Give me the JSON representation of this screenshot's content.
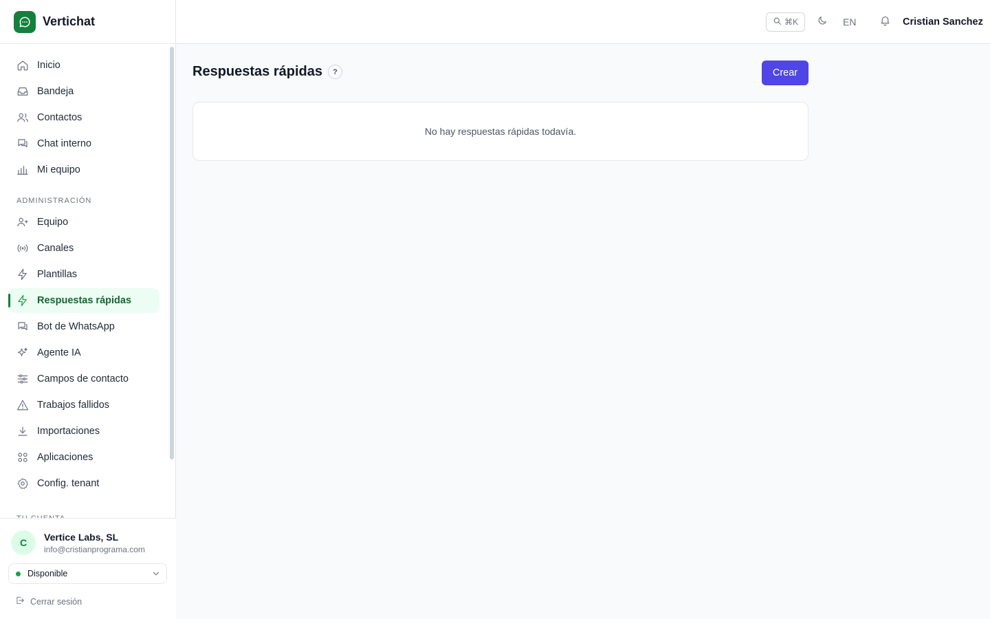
{
  "brand": {
    "name": "Vertichat"
  },
  "topbar": {
    "search_shortcut": "⌘K",
    "language": "EN",
    "user_name": "Cristian Sanchez"
  },
  "sidebar": {
    "main_items": [
      {
        "label": "Inicio",
        "icon": "home-icon"
      },
      {
        "label": "Bandeja",
        "icon": "inbox-icon"
      },
      {
        "label": "Contactos",
        "icon": "users-icon"
      },
      {
        "label": "Chat interno",
        "icon": "chat-icon"
      },
      {
        "label": "Mi equipo",
        "icon": "bar-chart-icon"
      }
    ],
    "admin_label": "ADMINISTRACIÓN",
    "admin_items": [
      {
        "label": "Equipo",
        "icon": "user-plus-icon"
      },
      {
        "label": "Canales",
        "icon": "broadcast-icon"
      },
      {
        "label": "Plantillas",
        "icon": "bolt-icon"
      },
      {
        "label": "Respuestas rápidas",
        "icon": "bolt-icon",
        "active": true
      },
      {
        "label": "Bot de WhatsApp",
        "icon": "chat-icon"
      },
      {
        "label": "Agente IA",
        "icon": "sparkles-icon"
      },
      {
        "label": "Campos de contacto",
        "icon": "sliders-icon"
      },
      {
        "label": "Trabajos fallidos",
        "icon": "warning-icon"
      },
      {
        "label": "Importaciones",
        "icon": "download-icon"
      },
      {
        "label": "Aplicaciones",
        "icon": "grid-icon"
      },
      {
        "label": "Config. tenant",
        "icon": "gear-icon"
      }
    ],
    "account_label": "TU CUENTA"
  },
  "account": {
    "avatar_initial": "C",
    "org_name": "Vertice Labs, SL",
    "email": "info@cristianprograma.com",
    "status": "Disponible",
    "logout_label": "Cerrar sesión"
  },
  "main": {
    "title": "Respuestas rápidas",
    "help": "?",
    "create_label": "Crear",
    "empty_message": "No hay respuestas rápidas todavía."
  },
  "colors": {
    "brand": "#15803d",
    "active_bg": "#ecfdf3",
    "primary_button": "#4f46e5",
    "status_available": "#16a34a"
  }
}
